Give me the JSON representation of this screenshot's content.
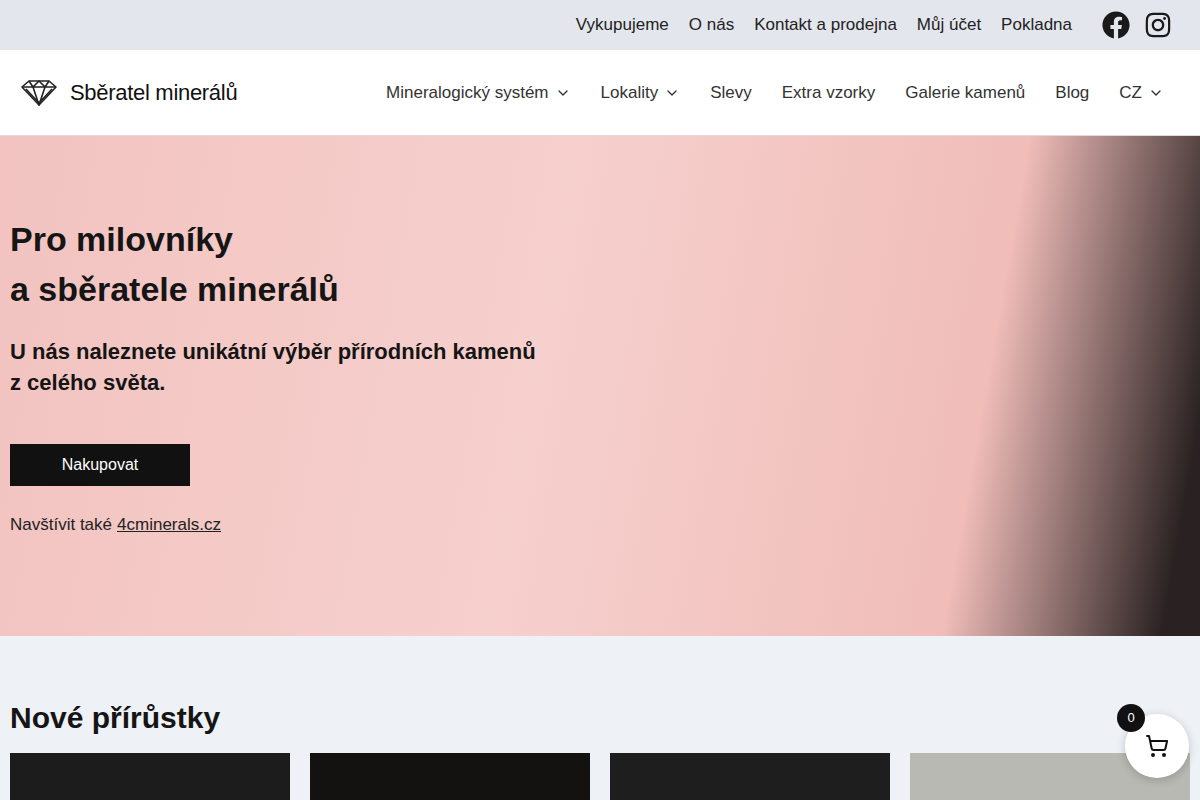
{
  "topbar": {
    "links": [
      "Vykupujeme",
      "O nás",
      "Kontakt a prodejna",
      "Můj účet",
      "Pokladna"
    ]
  },
  "header": {
    "logo": "Sběratel minerálů",
    "nav": [
      {
        "label": "Mineralogický systém",
        "dropdown": true
      },
      {
        "label": "Lokality",
        "dropdown": true
      },
      {
        "label": "Slevy",
        "dropdown": false
      },
      {
        "label": "Extra vzorky",
        "dropdown": false
      },
      {
        "label": "Galerie kamenů",
        "dropdown": false
      },
      {
        "label": "Blog",
        "dropdown": false
      },
      {
        "label": "CZ",
        "dropdown": true
      }
    ]
  },
  "hero": {
    "title_lines": [
      "Pro milovníky",
      "a sběratele minerálů"
    ],
    "subtitle_lines": [
      "U nás naleznete unikátní výběr přírodních kamenů",
      "z celého světa."
    ],
    "button": "Nakupovat",
    "visit_prefix": "Navštívit také",
    "visit_link": "4cminerals.cz"
  },
  "new_arrivals": {
    "title": "Nové přírůstky",
    "cards": [
      {
        "color": "#1c1c1c"
      },
      {
        "color": "#141210"
      },
      {
        "color": "#1e1e1e"
      },
      {
        "color": "#b9b9b4"
      }
    ]
  },
  "cart": {
    "count": "0"
  }
}
